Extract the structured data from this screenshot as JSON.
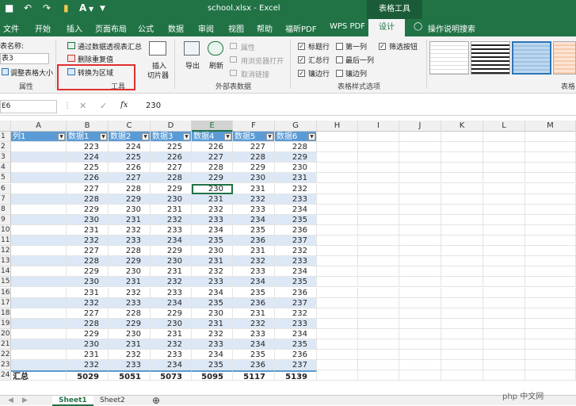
{
  "titlebar": {
    "title": "school.xlsx  -  Excel",
    "context": "表格工具",
    "undo_icon": "undo-icon",
    "redo_icon": "redo-icon"
  },
  "ribbon_tabs": [
    "文件",
    "开始",
    "插入",
    "页面布局",
    "公式",
    "数据",
    "审阅",
    "视图",
    "帮助",
    "福昕PDF",
    "WPS PDF",
    "设计"
  ],
  "active_tab": "设计",
  "search_hint": "操作说明搜索",
  "ribbon": {
    "table_name_label": "表名称:",
    "table_name_value": "表3",
    "resize_table": "调整表格大小",
    "group_properties": "属性",
    "summarize_pivot": "通过数据透视表汇总",
    "remove_duplicates": "删除重复值",
    "convert_to_range": "转换为区域",
    "group_tools": "工具",
    "insert_slicer_1": "插入",
    "insert_slicer_2": "切片器",
    "export": "导出",
    "refresh": "刷新",
    "properties": "属性",
    "open_in_browser": "用浏览器打开",
    "unlink": "取消链接",
    "group_external": "外部表数据",
    "header_row": "标题行",
    "first_column": "第一列",
    "filter_button": "筛选按钮",
    "total_row": "汇总行",
    "last_column": "最后一列",
    "banded_rows": "镶边行",
    "banded_columns": "镶边列",
    "group_style_options": "表格样式选项",
    "group_table_styles": "表格",
    "checkboxes": {
      "header_row": true,
      "first_column": false,
      "filter_button": true,
      "total_row": true,
      "last_column": false,
      "banded_rows": true,
      "banded_columns": false
    }
  },
  "formula_bar": {
    "name_box": "E6",
    "fx": "fx",
    "value": "230"
  },
  "columns": [
    "A",
    "B",
    "C",
    "D",
    "E",
    "F",
    "G",
    "H",
    "I",
    "J",
    "K",
    "L",
    "M"
  ],
  "table_headers": [
    "列1",
    "数据1",
    "数据2",
    "数据3",
    "数据4",
    "数据5",
    "数据6"
  ],
  "data_rows": [
    [
      "",
      "223",
      "224",
      "225",
      "226",
      "227",
      "228"
    ],
    [
      "",
      "224",
      "225",
      "226",
      "227",
      "228",
      "229"
    ],
    [
      "",
      "225",
      "226",
      "227",
      "228",
      "229",
      "230"
    ],
    [
      "",
      "226",
      "227",
      "228",
      "229",
      "230",
      "231"
    ],
    [
      "",
      "227",
      "228",
      "229",
      "230",
      "231",
      "232"
    ],
    [
      "",
      "228",
      "229",
      "230",
      "231",
      "232",
      "233"
    ],
    [
      "",
      "229",
      "230",
      "231",
      "232",
      "233",
      "234"
    ],
    [
      "",
      "230",
      "231",
      "232",
      "233",
      "234",
      "235"
    ],
    [
      "",
      "231",
      "232",
      "233",
      "234",
      "235",
      "236"
    ],
    [
      "",
      "232",
      "233",
      "234",
      "235",
      "236",
      "237"
    ],
    [
      "",
      "227",
      "228",
      "229",
      "230",
      "231",
      "232"
    ],
    [
      "",
      "228",
      "229",
      "230",
      "231",
      "232",
      "233"
    ],
    [
      "",
      "229",
      "230",
      "231",
      "232",
      "233",
      "234"
    ],
    [
      "",
      "230",
      "231",
      "232",
      "233",
      "234",
      "235"
    ],
    [
      "",
      "231",
      "232",
      "233",
      "234",
      "235",
      "236"
    ],
    [
      "",
      "232",
      "233",
      "234",
      "235",
      "236",
      "237"
    ],
    [
      "",
      "227",
      "228",
      "229",
      "230",
      "231",
      "232"
    ],
    [
      "",
      "228",
      "229",
      "230",
      "231",
      "232",
      "233"
    ],
    [
      "",
      "229",
      "230",
      "231",
      "232",
      "233",
      "234"
    ],
    [
      "",
      "230",
      "231",
      "232",
      "233",
      "234",
      "235"
    ],
    [
      "",
      "231",
      "232",
      "233",
      "234",
      "235",
      "236"
    ],
    [
      "",
      "232",
      "233",
      "234",
      "235",
      "236",
      "237"
    ]
  ],
  "total_row": [
    "汇总",
    "5029",
    "5051",
    "5073",
    "5095",
    "5117",
    "5139"
  ],
  "selected_cell": "E6",
  "sheet_tabs": [
    "Sheet1",
    "Sheet2"
  ],
  "active_sheet": "Sheet1",
  "watermark": "php 中文网",
  "colors": {
    "excel_green": "#217346",
    "header_blue": "#5b9bd5",
    "band_blue": "#dde8f6",
    "highlight_red": "#e03030"
  }
}
